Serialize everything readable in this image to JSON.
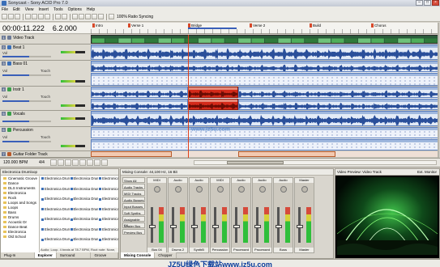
{
  "window": {
    "title": "Sonycast - Sony ACID Pro 7.0"
  },
  "menu": [
    "File",
    "Edit",
    "View",
    "Insert",
    "Tools",
    "Options",
    "Help"
  ],
  "toolbar": {
    "label_100": "100% Ratio Syncing"
  },
  "time": {
    "position": "00:00:11.222",
    "beats": "6.2.000"
  },
  "markers": [
    {
      "label": "Intro"
    },
    {
      "label": "Verse 1"
    },
    {
      "label": "Bridge"
    },
    {
      "label": "Verse 2"
    },
    {
      "label": "Build"
    },
    {
      "label": "Chorus"
    }
  ],
  "tracks": [
    {
      "num": "1",
      "name": "Video Track",
      "color": "#6c7a96"
    },
    {
      "num": "2",
      "name": "Beat 1",
      "color": "#3a6fb8",
      "vol": "Vol",
      "val": "100 Section"
    },
    {
      "num": "3",
      "name": "Bass 01",
      "color": "#3a6fb8",
      "vol": "Vol",
      "val": "Touch"
    },
    {
      "num": "4",
      "name": "Instr 1",
      "color": "#3a9f4a",
      "vol": "Vol",
      "val": "Touch"
    },
    {
      "num": "5",
      "name": "Vocals",
      "color": "#3a9f4a",
      "vol": "Vol",
      "val": "Touch"
    },
    {
      "num": "6",
      "name": "Percussion",
      "color": "#3a9f4a",
      "vol": "Vol",
      "val": "Touch"
    },
    {
      "num": "7",
      "name": "Guitar Folder Track",
      "color": "#b85a2a"
    }
  ],
  "transport": {
    "bpm": "120.000 BPM",
    "meter": "4/4"
  },
  "explorer": {
    "title": "Electronica Drumloop",
    "folders": [
      "Cinematic Groove",
      "Dance",
      "DLS Instruments",
      "Electronica",
      "Rock",
      "Loops and Songs",
      "Loops",
      "Bass",
      "Drums",
      "Acoustic Dr",
      "Dance Beat",
      "Electronica",
      "Old School"
    ],
    "files": [
      "Electronica Drumloop 01.wav",
      "Electronica Drumloop 08.wav",
      "Electronica",
      "Electronica Drumloop 02.wav",
      "Electronica Drumloop 09.wav",
      "Electronica",
      "Electronica Drumloop 03.wav",
      "Electronica Drumloop 10.wav",
      "Electronica",
      "Electronica Drumloop 04.wav",
      "Electronica Drumloop 11.wav",
      "Electronica",
      "Electronica Drumloop 05.wav",
      "Electronica Drumloop 12.wav",
      "Electronica",
      "Electronica Drumloop 06.wav",
      "Electronica Drumloop 13.wav",
      "Electronica",
      "Electronica Drumloop 07.wav",
      "Electronica Drumloop 14.wav",
      "Electronica"
    ],
    "status": "Audio: Loop, 4 beats at 78.7 BPM, Root note: None, 16 Bit",
    "tabs": [
      "Plug-In Manager",
      "Explorer",
      "Surround Panner",
      "Groove Pool"
    ]
  },
  "mixer": {
    "title": "Mixing Console: 44,100 Hz, 16 Bit",
    "side": [
      "Show All",
      "Audio Tracks",
      "MIDI Tracks",
      "Audio Busses",
      "Input Busses",
      "Soft Synths",
      "Assignable FX",
      "Master Bus",
      "Preview Bus"
    ],
    "strips": [
      {
        "name": "MIDI",
        "foot": "Bus 04"
      },
      {
        "name": "Audio",
        "foot": "Drums 2"
      },
      {
        "name": "Audio",
        "foot": "SynthB"
      },
      {
        "name": "MIDI",
        "foot": "Percussion"
      },
      {
        "name": "Audio",
        "foot": "Processed G"
      },
      {
        "name": "Audio",
        "foot": "Processed G"
      },
      {
        "name": "Audio",
        "foot": "Buss"
      },
      {
        "name": "Master",
        "foot": "Master"
      }
    ],
    "tabs": [
      "Mixing Console",
      "Chopper"
    ]
  },
  "preview": {
    "title": "Video Preview: Video Track",
    "ext": "Ext. Monitor"
  },
  "watermark": {
    "center": "www.jz5u.com",
    "bottom": "JZ5U绿色下载站www.jz5u.com"
  }
}
